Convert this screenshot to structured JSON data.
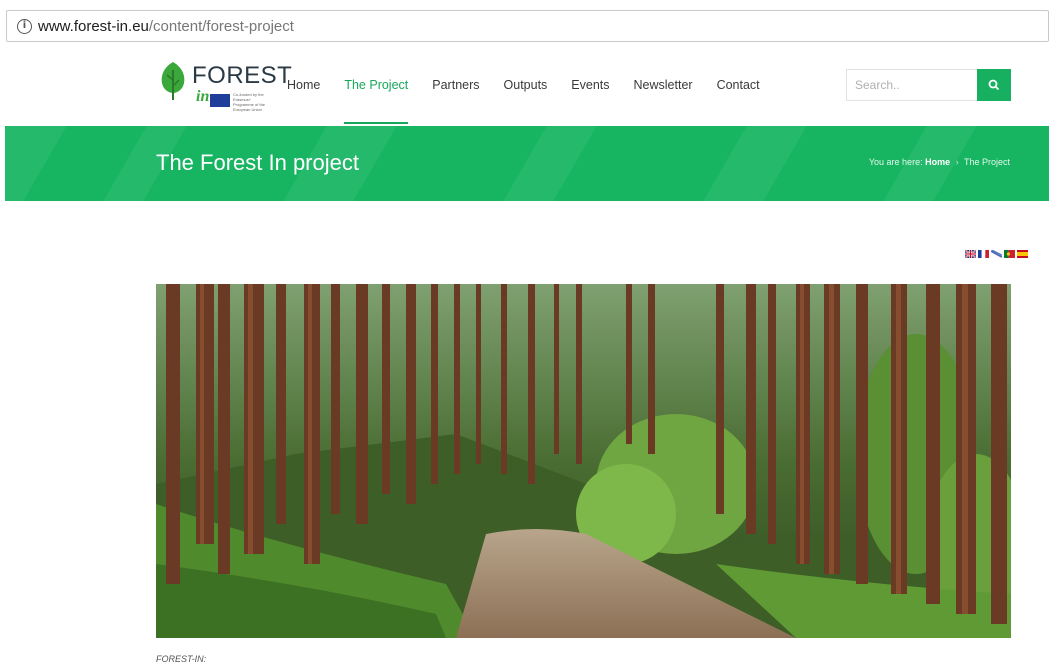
{
  "browser": {
    "url_domain": "www.forest-in.eu",
    "url_path": "/content/forest-project"
  },
  "logo": {
    "wordmark": "FOREST",
    "sub": "in",
    "eu_text": "Co-funded by the Erasmus+ Programme of the European Union",
    "brand_color": "#3aa83a"
  },
  "nav": {
    "items": [
      {
        "label": "Home",
        "active": false
      },
      {
        "label": "The Project",
        "active": true
      },
      {
        "label": "Partners",
        "active": false
      },
      {
        "label": "Outputs",
        "active": false
      },
      {
        "label": "Events",
        "active": false
      },
      {
        "label": "Newsletter",
        "active": false
      },
      {
        "label": "Contact",
        "active": false
      }
    ],
    "accent": "#16a85a"
  },
  "search": {
    "placeholder": "Search..",
    "icon": "search-icon"
  },
  "banner": {
    "title": "The Forest In project",
    "breadcrumb_prefix": "You are here:",
    "breadcrumb_home": "Home",
    "breadcrumb_sep": "›",
    "breadcrumb_current": "The Project",
    "color": "#17b562"
  },
  "languages": [
    "en-flag-icon",
    "fr-flag-icon",
    "gr-flag-icon",
    "pt-flag-icon",
    "es-flag-icon"
  ],
  "content": {
    "caption": "FOREST-IN:"
  }
}
